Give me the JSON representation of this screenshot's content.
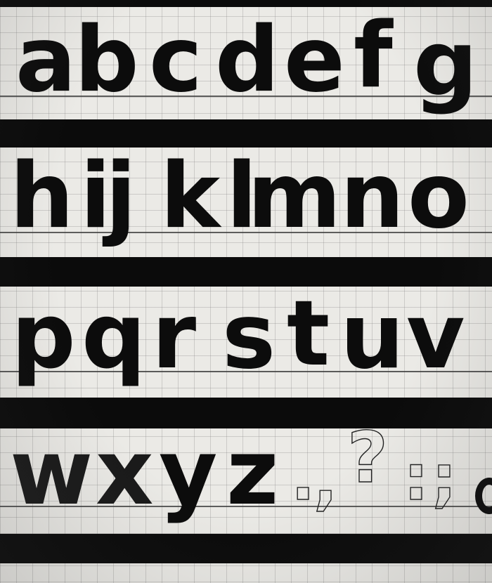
{
  "rows": [
    {
      "letters": [
        "a",
        "b",
        "c",
        "d",
        "e",
        "f",
        "g"
      ]
    },
    {
      "letters": [
        "h",
        "i",
        "j",
        "k",
        "l",
        "m",
        "n",
        "o"
      ]
    },
    {
      "letters": [
        "p",
        "q",
        "r",
        "s",
        "t",
        "u",
        "v"
      ]
    },
    {
      "letters": [
        "w",
        "x",
        "y",
        "z"
      ],
      "sketch_marks": [
        ".",
        ",",
        "?",
        ":",
        ";"
      ]
    }
  ],
  "colors": {
    "ink": "#0c0c0c",
    "paper": "#ebeae6",
    "grid": "#9a9a9a"
  }
}
